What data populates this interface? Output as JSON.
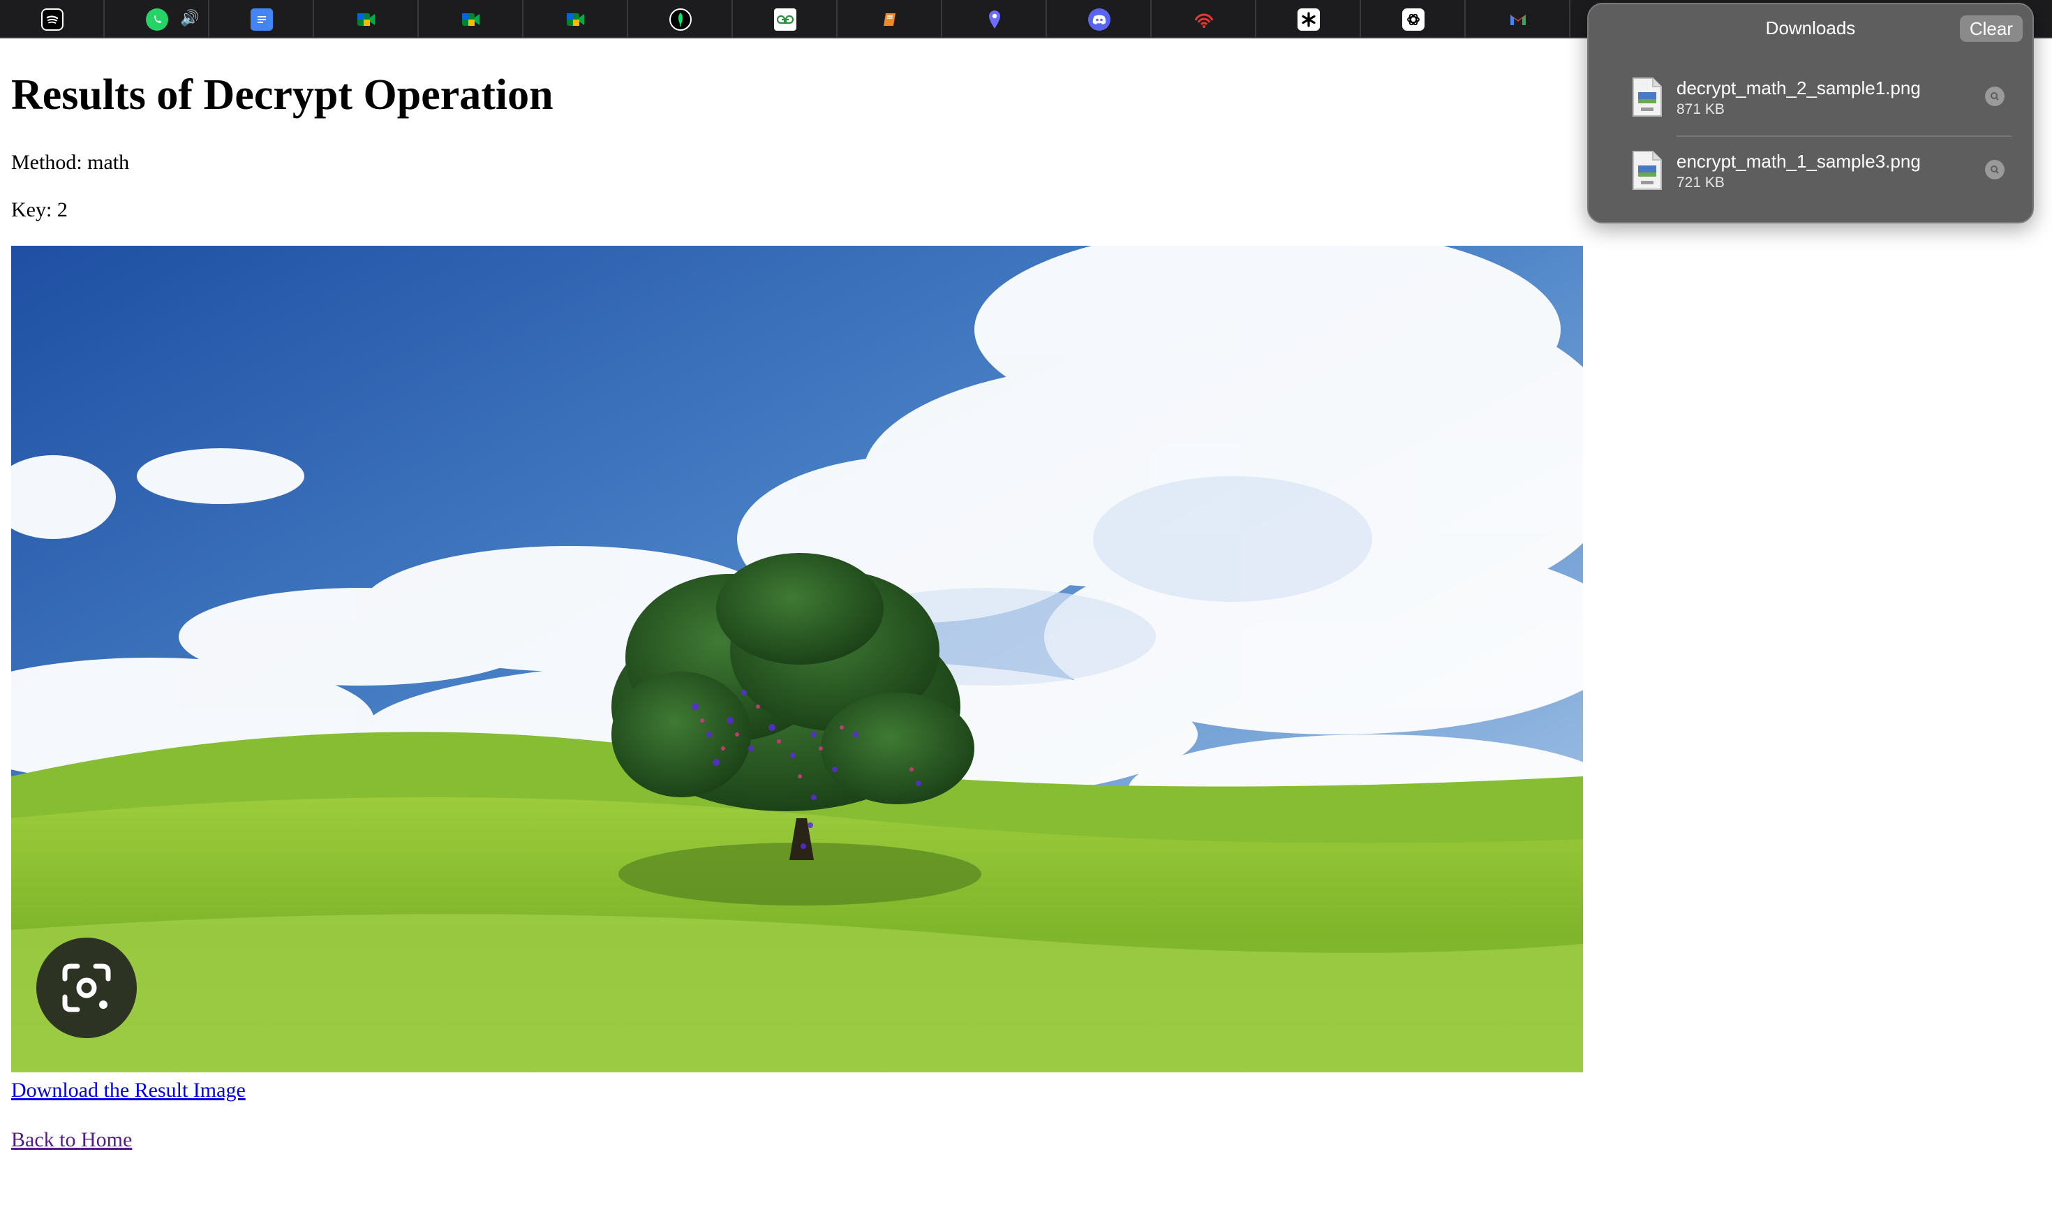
{
  "tabs": [
    {
      "icon": "spotify-icon",
      "color": "#1db954"
    },
    {
      "icon": "whatsapp-icon",
      "color": "#25d366",
      "audio": true
    },
    {
      "icon": "google-docs-icon",
      "color": "#4285f4"
    },
    {
      "icon": "google-meet-icon",
      "color": "#00897b"
    },
    {
      "icon": "google-meet-icon",
      "color": "#00897b"
    },
    {
      "icon": "google-meet-icon",
      "color": "#00897b"
    },
    {
      "icon": "mongodb-icon",
      "color": "#00684a"
    },
    {
      "icon": "geeksforgeeks-icon",
      "color": "#2f8d46"
    },
    {
      "icon": "book-icon",
      "color": "#f08a24"
    },
    {
      "icon": "location-pin-icon",
      "color": "#6c6cff"
    },
    {
      "icon": "discord-icon",
      "color": "#5865f2"
    },
    {
      "icon": "wifi-red-icon",
      "color": "#e53935"
    },
    {
      "icon": "asterisk-icon",
      "color": "#ffffff"
    },
    {
      "icon": "openai-icon",
      "color": "#ffffff"
    },
    {
      "icon": "gmail-icon",
      "color": "#ea4335"
    }
  ],
  "page": {
    "title": "Results of Decrypt Operation",
    "method_text": "Method: math",
    "key_text": "Key: 2",
    "download_link": "Download the Result Image",
    "home_link": "Back to Home"
  },
  "downloads": {
    "title": "Downloads",
    "clear_label": "Clear",
    "items": [
      {
        "name": "decrypt_math_2_sample1.png",
        "size": "871 KB"
      },
      {
        "name": "encrypt_math_1_sample3.png",
        "size": "721 KB"
      }
    ]
  }
}
